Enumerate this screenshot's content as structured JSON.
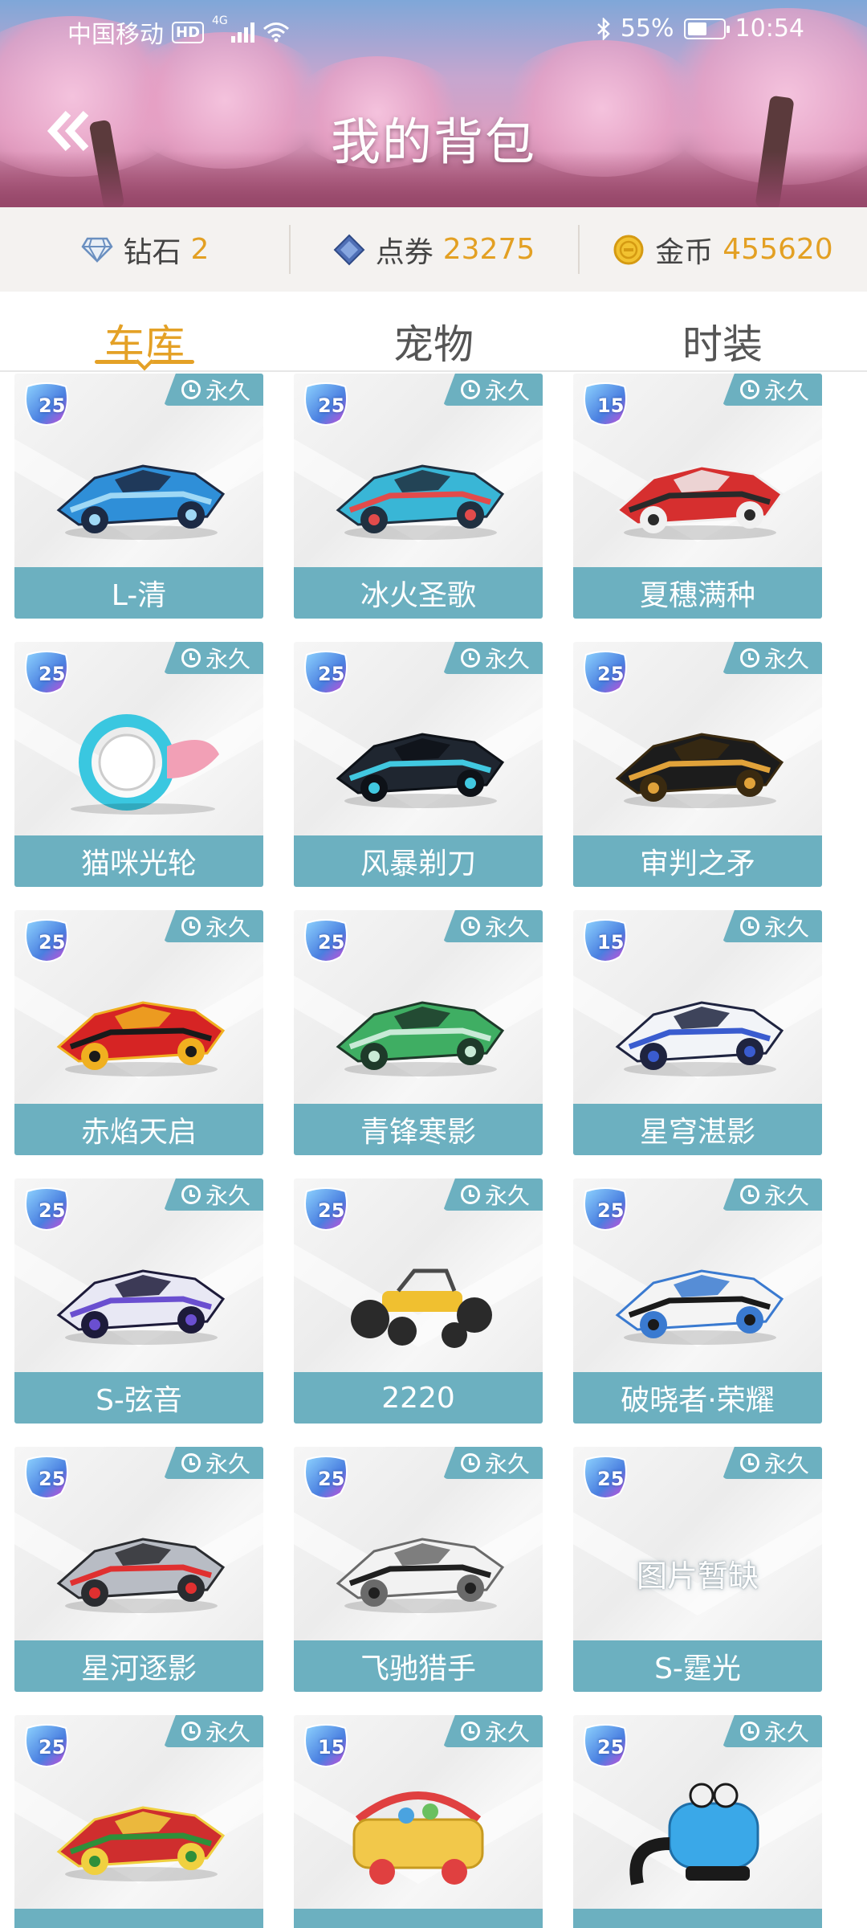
{
  "status_bar": {
    "carrier": "中国移动",
    "hd": "HD",
    "network": "4G",
    "battery": "55%",
    "battery_level": 0.55,
    "time": "10:54"
  },
  "header": {
    "title": "我的背包",
    "back_icon": "double-chevron-left-icon"
  },
  "currencies": [
    {
      "icon": "diamond-icon",
      "label": "钻石",
      "value": "2"
    },
    {
      "icon": "coupon-icon",
      "label": "点券",
      "value": "23275"
    },
    {
      "icon": "coin-icon",
      "label": "金币",
      "value": "455620"
    }
  ],
  "tabs": [
    {
      "label": "车库",
      "active": true
    },
    {
      "label": "宠物",
      "active": false
    },
    {
      "label": "时装",
      "active": false
    }
  ],
  "colors": {
    "accent": "#e4a126",
    "card_label_bg": "#6cb0c0",
    "currency_value": "#e3a023"
  },
  "cards": [
    {
      "name": "L-清",
      "level": "25",
      "tag": "永久",
      "art": "car-blue-sleek"
    },
    {
      "name": "冰火圣歌",
      "level": "25",
      "tag": "永久",
      "art": "car-cyan-red"
    },
    {
      "name": "夏穗满种",
      "level": "15",
      "tag": "永久",
      "art": "car-formula-red"
    },
    {
      "name": "猫咪光轮",
      "level": "25",
      "tag": "永久",
      "art": "car-cat-wheel"
    },
    {
      "name": "风暴剃刀",
      "level": "25",
      "tag": "永久",
      "art": "car-black-cyan"
    },
    {
      "name": "审判之矛",
      "level": "25",
      "tag": "永久",
      "art": "car-black-gold"
    },
    {
      "name": "赤焰天启",
      "level": "25",
      "tag": "永久",
      "art": "car-red-black"
    },
    {
      "name": "青锋寒影",
      "level": "25",
      "tag": "永久",
      "art": "car-green"
    },
    {
      "name": "星穹湛影",
      "level": "15",
      "tag": "永久",
      "art": "car-white-blue"
    },
    {
      "name": "S-弦音",
      "level": "25",
      "tag": "永久",
      "art": "car-purple-white"
    },
    {
      "name": "2220",
      "level": "25",
      "tag": "永久",
      "art": "car-buggy-yellow"
    },
    {
      "name": "破晓者·荣耀",
      "level": "25",
      "tag": "永久",
      "art": "car-white-black"
    },
    {
      "name": "星河逐影",
      "level": "25",
      "tag": "永久",
      "art": "car-silver"
    },
    {
      "name": "飞驰猎手",
      "level": "25",
      "tag": "永久",
      "art": "car-white-dark"
    },
    {
      "name": "S-霆光",
      "level": "25",
      "tag": "永久",
      "art": "",
      "missing_text": "图片暂缺"
    },
    {
      "name": "",
      "level": "25",
      "tag": "永久",
      "art": "car-christmas-red"
    },
    {
      "name": "",
      "level": "15",
      "tag": "永久",
      "art": "car-toy-basket"
    },
    {
      "name": "",
      "level": "25",
      "tag": "永久",
      "art": "car-blue-vacuum"
    }
  ]
}
